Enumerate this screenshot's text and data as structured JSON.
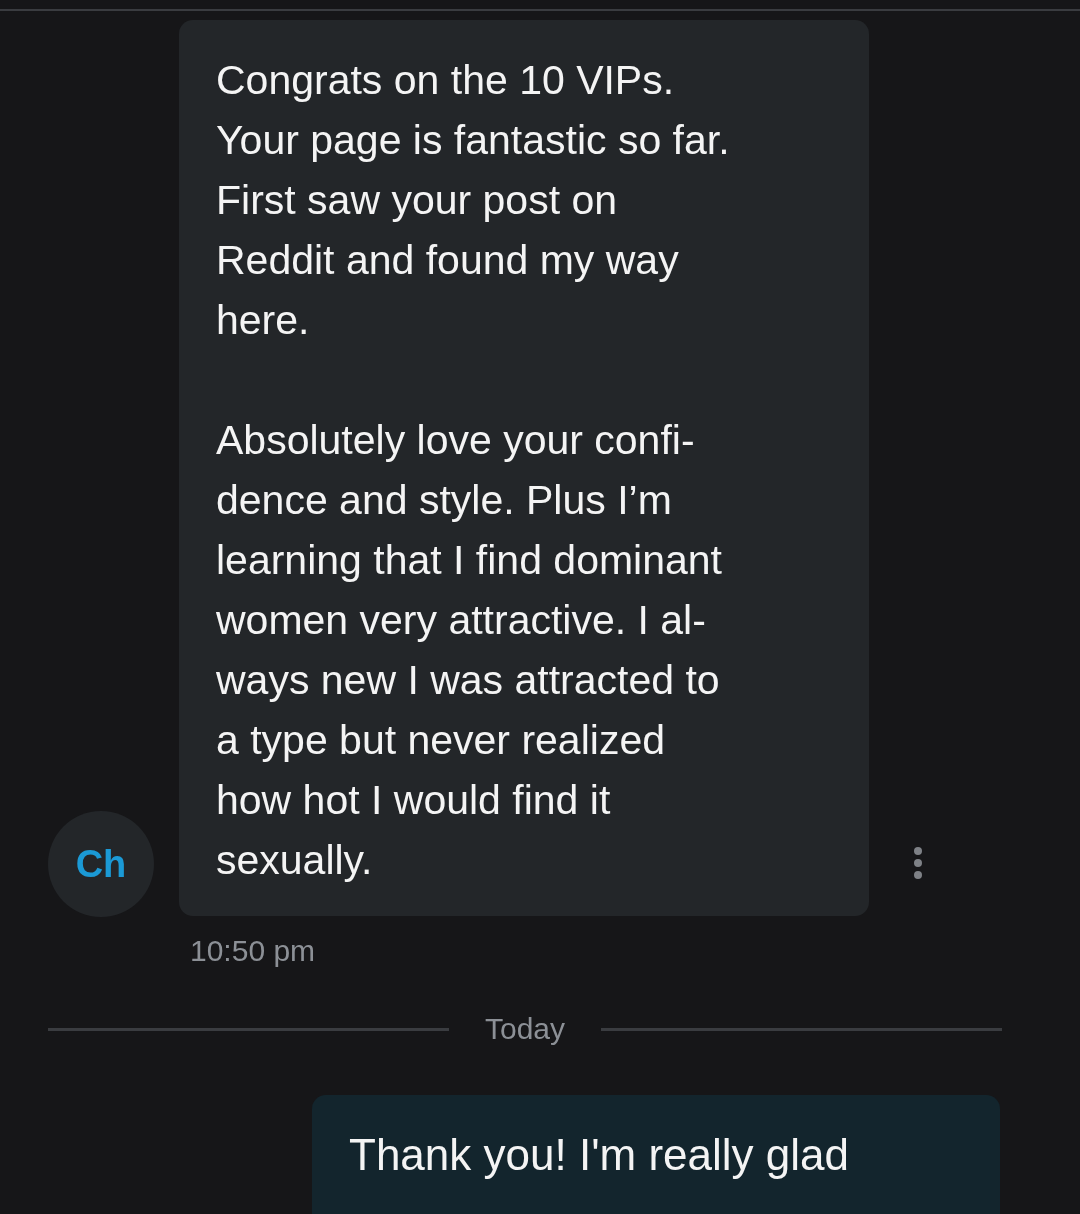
{
  "messages": [
    {
      "kind": "incoming",
      "avatar": "Ch",
      "paragraphs": [
        [
          "Congrats on the 10 VIPs.",
          "Your page is fantastic so far.",
          "First saw your post on",
          "Reddit and found my way",
          "here."
        ],
        [
          "Absolutely love your confi-",
          "dence and style. Plus I’m",
          "learning that I find dominant",
          "women very attractive. I al-",
          "ways new I was attracted to",
          "a type but never realized",
          "how hot I would find it",
          "sexually."
        ]
      ],
      "time": "10:50 pm"
    }
  ],
  "day_divider": "Today",
  "outgoing": {
    "kind": "outgoing",
    "paragraphs": [
      [
        "Thank you! I'm really glad"
      ]
    ]
  }
}
